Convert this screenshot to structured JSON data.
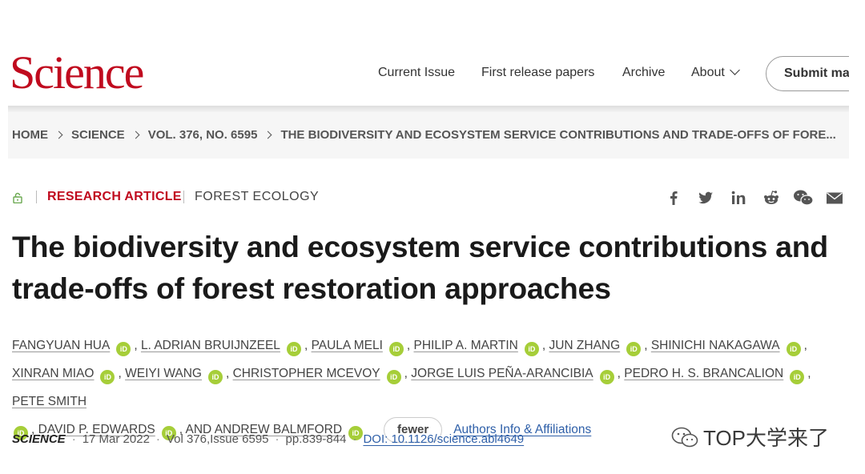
{
  "header": {
    "logo": "Science",
    "nav": [
      "Current Issue",
      "First release papers",
      "Archive",
      "About"
    ],
    "submit_label": "Submit manuscript"
  },
  "breadcrumb": {
    "items": [
      "HOME",
      "SCIENCE",
      "VOL. 376, NO. 6595",
      "THE BIODIVERSITY AND ECOSYSTEM SERVICE CONTRIBUTIONS AND TRADE-OFFS OF FORE..."
    ]
  },
  "article": {
    "type": "RESEARCH ARTICLE",
    "section": "FOREST ECOLOGY",
    "title": "The biodiversity and ecosystem service contributions and trade-offs of forest restoration approaches",
    "authors": [
      "FANGYUAN HUA",
      "L. ADRIAN BRUIJNZEEL",
      "PAULA MELI",
      "PHILIP A. MARTIN",
      "JUN ZHANG",
      "SHINICHI NAKAGAWA",
      "XINRAN MIAO",
      "WEIYI WANG",
      "CHRISTOPHER MCEVOY",
      "JORGE LUIS PEÑA-ARANCIBIA",
      "PEDRO H. S. BRANCALION",
      "PETE SMITH",
      "DAVID P. EDWARDS",
      "ANDREW BALMFORD"
    ],
    "orcid_label": "iD",
    "and_label": ", AND ",
    "fewer_label": "fewer",
    "affiliations_link": "Authors Info & Affiliations"
  },
  "citation": {
    "journal": "SCIENCE",
    "date": "17 Mar 2022",
    "volume": "Vol 376,Issue 6595",
    "pages": "pp.839-844",
    "doi": "DOI: 10.1126/science.abl4649"
  },
  "share_icons": [
    "facebook-icon",
    "twitter-icon",
    "linkedin-icon",
    "reddit-icon",
    "wechat-icon",
    "email-icon"
  ],
  "watermark": "TOP大学来了",
  "colors": {
    "brand_red": "#c00a1e",
    "link_blue": "#2e5fa8",
    "orcid_green": "#a6ce39"
  }
}
